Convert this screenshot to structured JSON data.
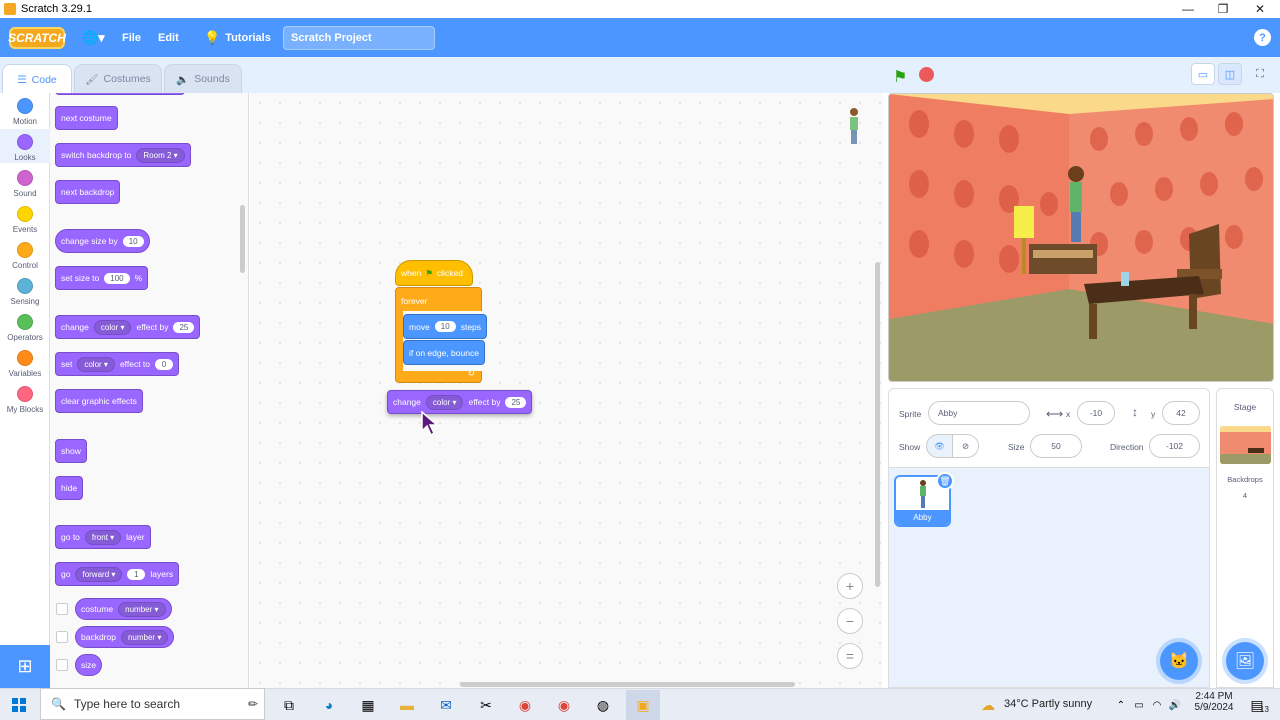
{
  "window": {
    "title": "Scratch 3.29.1",
    "minimize": "—",
    "maximize": "❐",
    "close": "✕"
  },
  "menubar": {
    "logo": "SCRATCH",
    "globe": "🌐▾",
    "file": "File",
    "edit": "Edit",
    "tutorials": "Tutorials",
    "project_title": "Scratch Project",
    "help": "?"
  },
  "tabs": {
    "code": "Code",
    "costumes": "Costumes",
    "sounds": "Sounds"
  },
  "categories": [
    {
      "label": "Motion",
      "color": "#4c97ff"
    },
    {
      "label": "Looks",
      "color": "#9966ff"
    },
    {
      "label": "Sound",
      "color": "#cf63cf"
    },
    {
      "label": "Events",
      "color": "#ffd500"
    },
    {
      "label": "Control",
      "color": "#ffab19"
    },
    {
      "label": "Sensing",
      "color": "#5cb1d6"
    },
    {
      "label": "Operators",
      "color": "#59c059"
    },
    {
      "label": "Variables",
      "color": "#ff8c1a"
    },
    {
      "label": "My Blocks",
      "color": "#ff6680"
    }
  ],
  "palette": {
    "next_costume": "next costume",
    "switch_backdrop": "switch backdrop to",
    "backdrop_value": "Room 2",
    "next_backdrop": "next backdrop",
    "change_size": "change size by",
    "change_size_value": "10",
    "set_size": "set size to",
    "set_size_value": "100",
    "percent": "%",
    "change_effect": "change",
    "effect_color": "color",
    "effect_by": "effect by",
    "effect_value": "25",
    "set_effect": "set",
    "effect_to": "effect to",
    "set_effect_value": "0",
    "clear_effects": "clear graphic effects",
    "show": "show",
    "hide": "hide",
    "go_to": "go to",
    "front": "front",
    "layer": "layer",
    "go": "go",
    "forward": "forward",
    "layers_value": "1",
    "layers": "layers",
    "costume": "costume",
    "backdrop": "backdrop",
    "number": "number",
    "size": "size"
  },
  "script": {
    "when": "when",
    "clicked": "clicked",
    "forever": "forever",
    "move": "move",
    "move_value": "10",
    "steps": "steps",
    "bounce": "if on edge, bounce",
    "loop_arrow": "↻",
    "dragged_change": "change",
    "dragged_effect": "color",
    "dragged_by": "effect by",
    "dragged_value": "25"
  },
  "zoom": {
    "in": "+",
    "out": "−",
    "reset": "="
  },
  "sprite_info": {
    "sprite_label": "Sprite",
    "sprite_name": "Abby",
    "x_label": "x",
    "x_value": "-10",
    "y_label": "y",
    "y_value": "42",
    "show_label": "Show",
    "size_label": "Size",
    "size_value": "50",
    "direction_label": "Direction",
    "direction_value": "-102"
  },
  "sprite_tile": {
    "name": "Abby"
  },
  "stage_pane": {
    "title": "Stage",
    "backdrops_label": "Backdrops",
    "backdrops_count": "4"
  },
  "taskbar": {
    "search_placeholder": "Type here to search",
    "weather": "34°C  Partly sunny",
    "time": "2:44 PM",
    "date": "5/9/2024",
    "notifications": "13"
  }
}
